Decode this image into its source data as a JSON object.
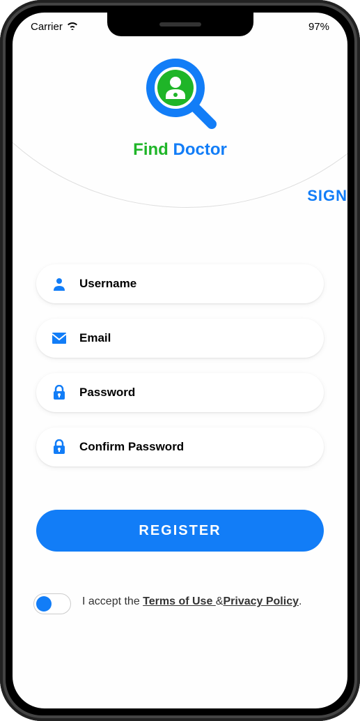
{
  "statusBar": {
    "carrier": "Carrier",
    "battery": "97%"
  },
  "appName": {
    "word1": "Find",
    "word2": "Doctor"
  },
  "signLink": "SIGN",
  "fields": {
    "username": {
      "placeholder": "Username"
    },
    "email": {
      "placeholder": "Email"
    },
    "password": {
      "placeholder": "Password"
    },
    "confirmPassword": {
      "placeholder": "Confirm Password"
    }
  },
  "registerButton": "REGISTER",
  "terms": {
    "prefix": "I accept the ",
    "termsOfUse": "Terms of Use ",
    "and": "&",
    "privacyPolicy": "Privacy Policy",
    "period": "."
  }
}
